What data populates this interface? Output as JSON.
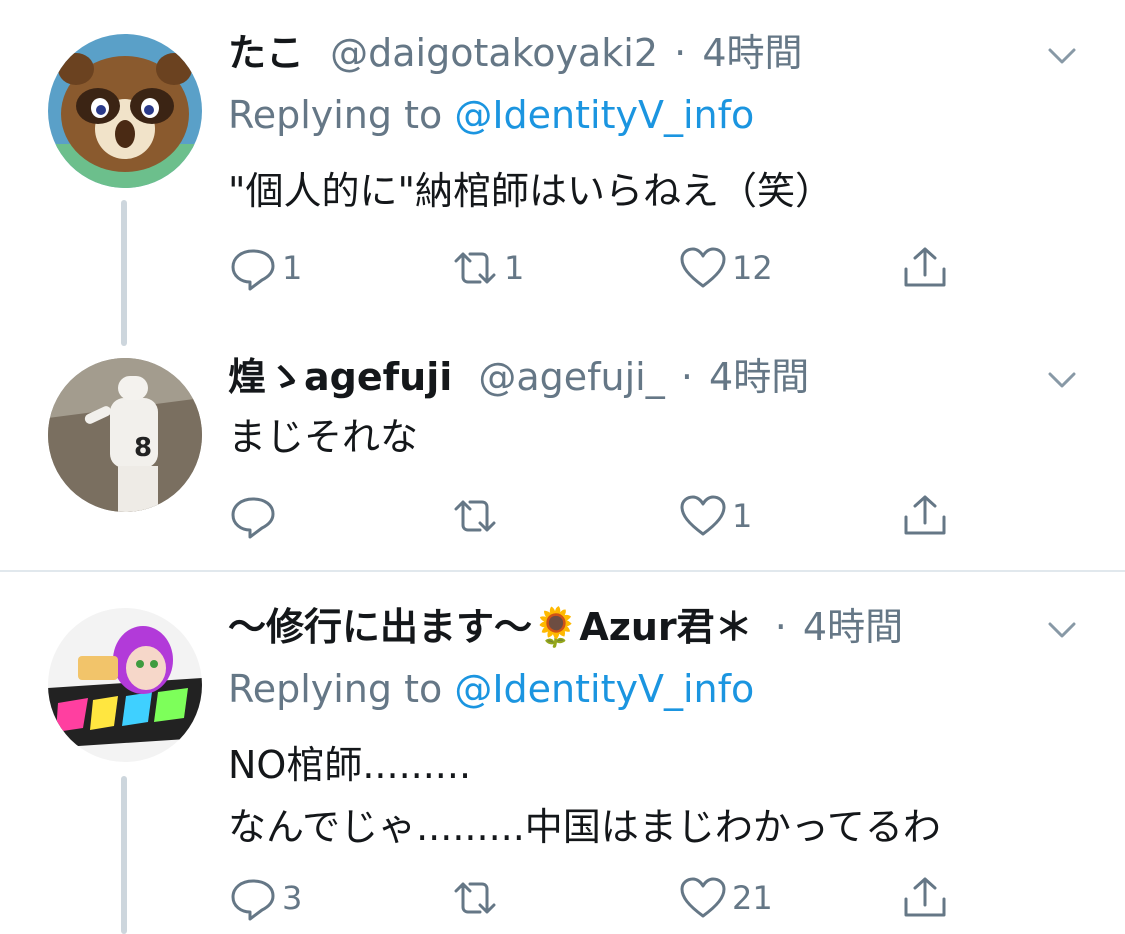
{
  "tweets": [
    {
      "name": "たこ",
      "handle": "@daigotakoyaki2",
      "dot": "·",
      "time": "4時間",
      "reply_prefix": "Replying to",
      "reply_mention": "@IdentityV_info",
      "text_lines": [
        "\"個人的に\"納棺師はいらねえ（笑）"
      ],
      "replies": "1",
      "retweets": "1",
      "likes": "12"
    },
    {
      "name": "煌ゝagefuji",
      "handle": "@agefuji_",
      "dot": "·",
      "time": "4時間",
      "text_lines": [
        "まじそれな"
      ],
      "replies": "",
      "retweets": "",
      "likes": "1"
    },
    {
      "name": "〜修行に出ます〜🌻Azur君＊",
      "handle": "",
      "dot": "·",
      "time": "4時間",
      "reply_prefix": "Replying to",
      "reply_mention": "@IdentityV_info",
      "text_lines": [
        "NO棺師.........",
        "なんでじゃ.........中国はまじわかってるわ"
      ],
      "replies": "3",
      "retweets": "",
      "likes": "21"
    }
  ],
  "icons": [
    "reply-icon",
    "retweet-icon",
    "like-icon",
    "share-icon",
    "chevron-down-icon"
  ],
  "colors": {
    "link": "#1b95e0",
    "secondary_text": "#657786",
    "primary_text": "#14171a",
    "divider": "#e1e8ed",
    "thread_line": "#cdd6dd"
  }
}
